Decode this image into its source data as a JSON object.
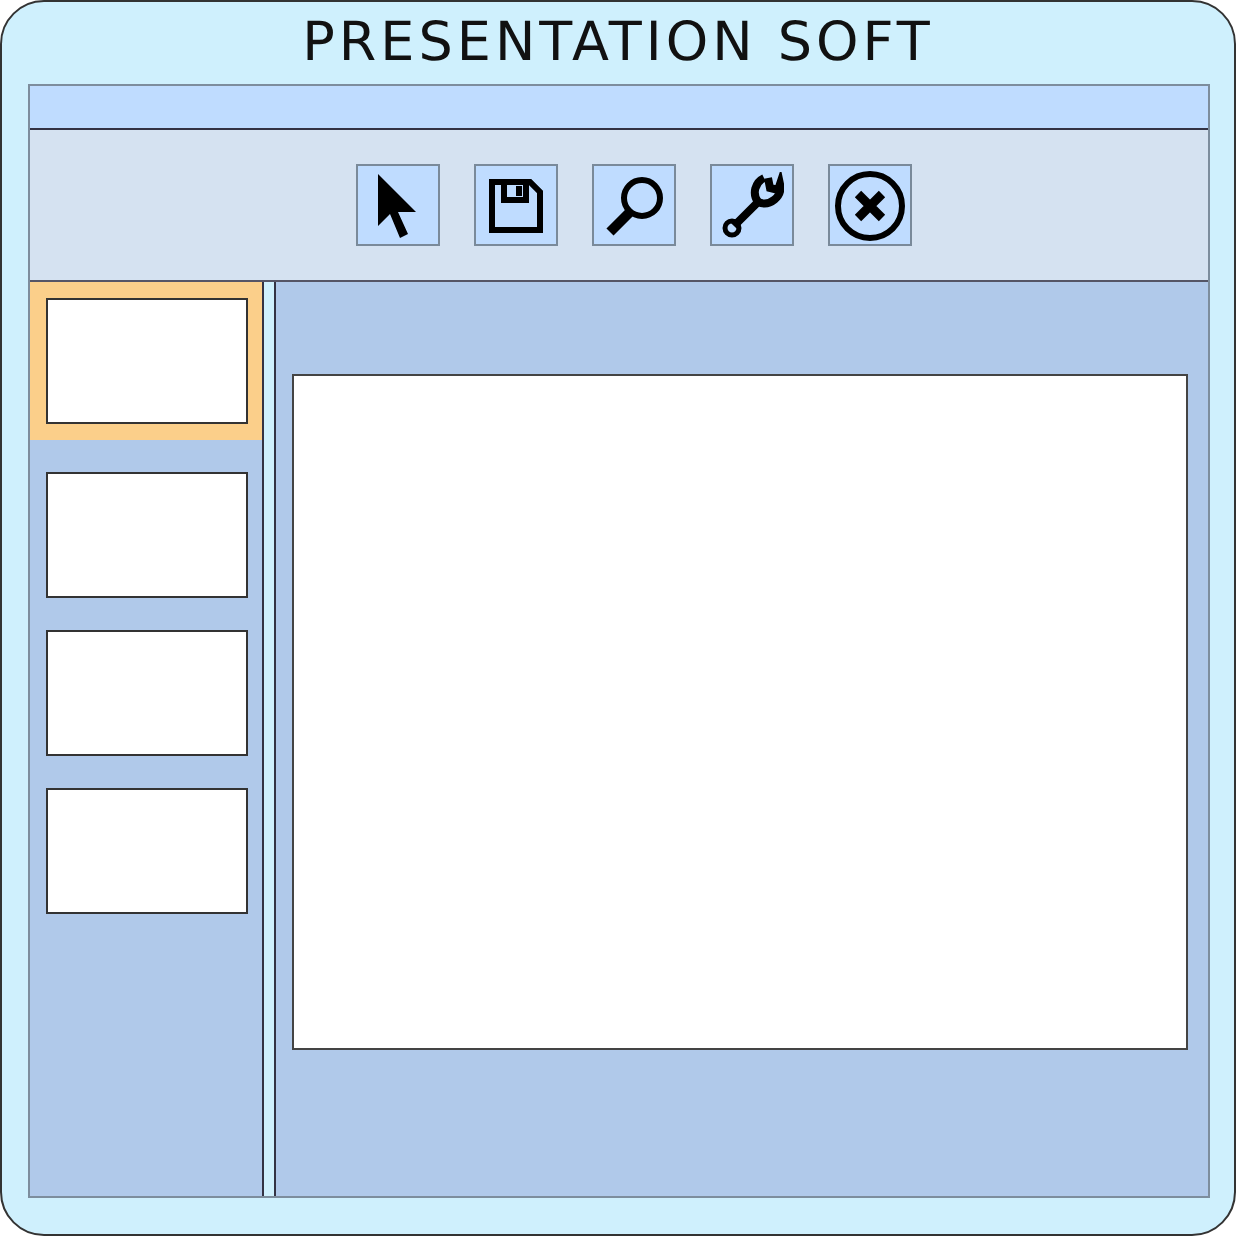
{
  "window": {
    "title": "PRESENTATION SOFT"
  },
  "toolbar": [
    {
      "kind": "pointer"
    },
    {
      "kind": "save"
    },
    {
      "kind": "search"
    },
    {
      "kind": "settings"
    },
    {
      "kind": "close"
    }
  ],
  "slides": [
    {
      "selected": true
    },
    {
      "selected": false
    },
    {
      "selected": false
    },
    {
      "selected": false
    }
  ]
}
